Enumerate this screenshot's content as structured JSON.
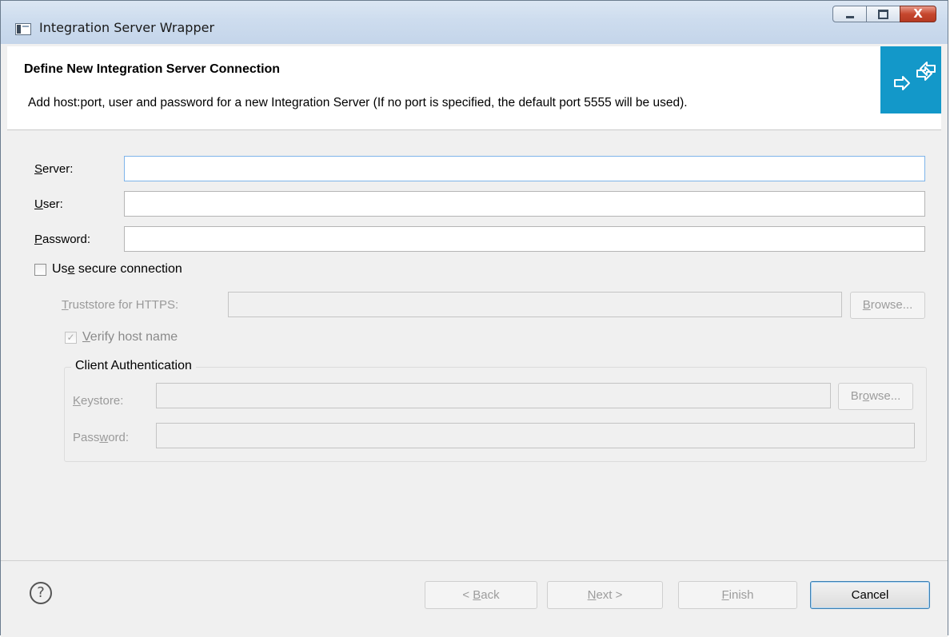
{
  "window": {
    "title": "Integration Server Wrapper",
    "controls": {
      "minimize_icon": "minimize-icon",
      "maximize_icon": "maximize-icon",
      "close_glyph": "X"
    }
  },
  "banner": {
    "title": "Define New Integration Server Connection",
    "description": "Add host:port, user and password for a new Integration Server (If no port is specified, the default port 5555 will be used).",
    "icon": "connection-arrows-icon",
    "accent_color": "#1398c9"
  },
  "form": {
    "server": {
      "label_mnemonic": "S",
      "label_rest": "erver:",
      "value": ""
    },
    "user": {
      "label_mnemonic": "U",
      "label_rest": "ser:",
      "value": ""
    },
    "password": {
      "label_mnemonic": "P",
      "label_rest": "assword:",
      "value": ""
    },
    "secure": {
      "label_pre": "Us",
      "label_mnemonic": "e",
      "label_post": " secure connection",
      "checked": false
    },
    "truststore": {
      "label_mnemonic": "T",
      "label_rest": "ruststore for HTTPS:",
      "value": "",
      "browse_mnemonic": "B",
      "browse_rest": "rowse..."
    },
    "verify_host": {
      "label_mnemonic": "V",
      "label_rest": "erify host name",
      "checked": true,
      "check_glyph": "✓"
    },
    "client_auth": {
      "title": "Client Authentication",
      "keystore": {
        "label_mnemonic": "K",
        "label_rest": "eystore:",
        "value": "",
        "browse_pre": "Br",
        "browse_mnemonic": "o",
        "browse_post": "wse..."
      },
      "password": {
        "label_pre": "Pass",
        "label_mnemonic": "w",
        "label_post": "ord:",
        "value": ""
      }
    }
  },
  "footer": {
    "help_glyph": "?",
    "back": {
      "pre": "< ",
      "mnemonic": "B",
      "post": "ack"
    },
    "next": {
      "mnemonic": "N",
      "post": "ext >"
    },
    "finish": {
      "mnemonic": "F",
      "post": "inish"
    },
    "cancel": "Cancel"
  }
}
